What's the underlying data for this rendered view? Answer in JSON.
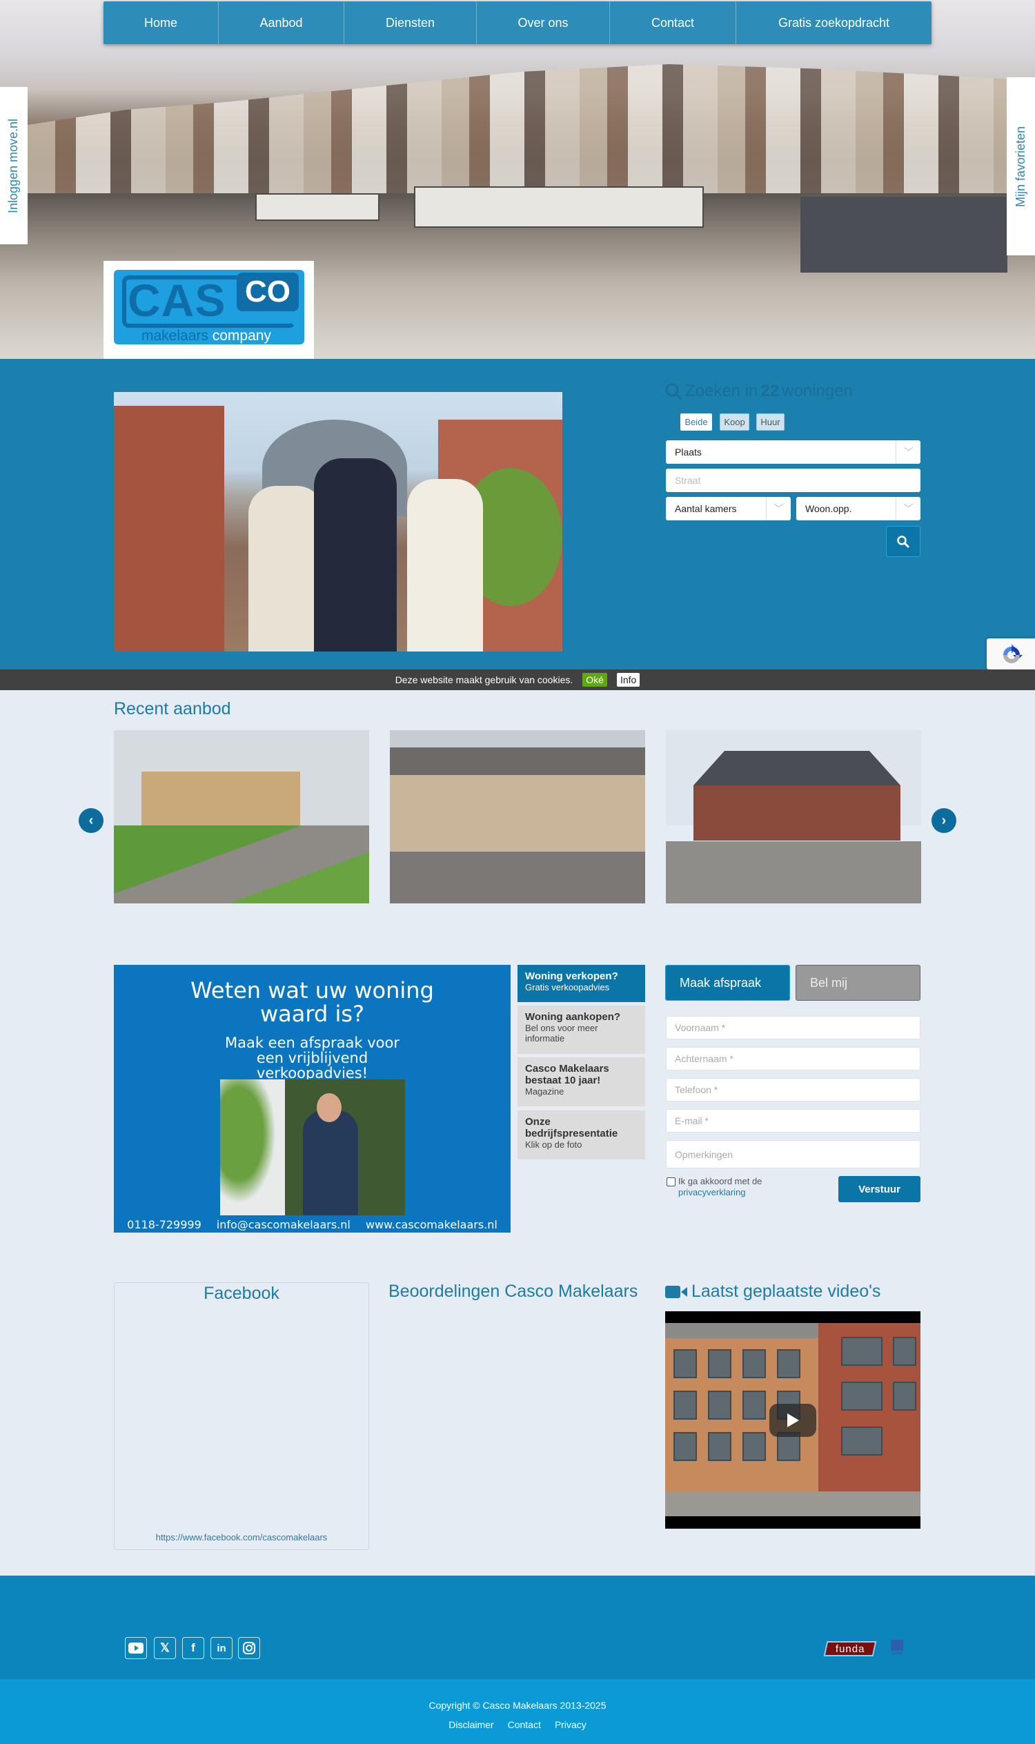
{
  "nav": {
    "items": [
      {
        "label": "Home"
      },
      {
        "label": "Aanbod"
      },
      {
        "label": "Diensten"
      },
      {
        "label": "Over ons"
      },
      {
        "label": "Contact"
      },
      {
        "label": "Gratis zoekopdracht"
      }
    ]
  },
  "side_tabs": {
    "login": "Inloggen move.nl",
    "favorites": "Mijn favorieten"
  },
  "logo": {
    "main": "CAS",
    "co": "CO",
    "tag_left": "makelaars",
    "tag_right": "company"
  },
  "search": {
    "title_prefix": "Zoeken in",
    "count": "22",
    "title_suffix": "woningen",
    "types": [
      "Beide",
      "Koop",
      "Huur"
    ],
    "active_type": "Beide",
    "plaats": "Plaats",
    "straat_placeholder": "Straat",
    "kamers": "Aantal kamers",
    "woonopp": "Woon.opp."
  },
  "cookie": {
    "text": "Deze website maakt gebruik van cookies.",
    "ok": "Oké",
    "info": "Info"
  },
  "recent": {
    "title": "Recent aanbod",
    "prev": "‹",
    "next": "›",
    "listings": [
      {
        "alt": "Appartementencomplex"
      },
      {
        "alt": "Rijwoningen"
      },
      {
        "alt": "Hoekwoning"
      }
    ]
  },
  "promo": {
    "heading": "Weten wat uw woning waard is?",
    "sub": "Maak een afspraak voor een vrijblijvend verkoopadvies!",
    "phone": "0118-729999",
    "email": "info@cascomakelaars.nl",
    "website": "www.cascomakelaars.nl"
  },
  "side_links": [
    {
      "title": "Woning verkopen?",
      "sub": "Gratis verkoopadvies",
      "active": true
    },
    {
      "title": "Woning aankopen?",
      "sub": "Bel ons voor meer informatie",
      "active": false
    },
    {
      "title": "Casco Makelaars bestaat 10 jaar!",
      "sub": "Magazine",
      "active": false
    },
    {
      "title": "Onze bedrijfspresentatie",
      "sub": "Klik op de foto",
      "active": false
    }
  ],
  "form": {
    "tab_active": "Maak afspraak",
    "tab_inactive": "Bel mij",
    "voornaam": "Voornaam *",
    "achternaam": "Achternaam *",
    "telefoon": "Telefoon *",
    "email": "E-mail *",
    "opmerkingen": "Opmerkingen",
    "agree_text": "Ik ga akkoord met de",
    "agree_link": "privacyverklaring",
    "submit": "Verstuur"
  },
  "facebook": {
    "title": "Facebook",
    "url": "https://www.facebook.com/cascomakelaars"
  },
  "reviews": {
    "title": "Beoordelingen Casco Makelaars"
  },
  "videos": {
    "title": "Laatst geplaatste video's"
  },
  "footer": {
    "social": [
      "youtube",
      "x",
      "facebook",
      "linkedin",
      "instagram"
    ],
    "funda": "funda",
    "nvm": "NVM",
    "copyright": "Copyright © Casco Makelaars 2013-2025",
    "links": [
      "Disclaimer",
      "Contact",
      "Privacy"
    ]
  },
  "colors": {
    "nav": "#2d8db8",
    "band": "#1b80ad",
    "accent": "#0b75a8",
    "promo": "#0b75bf",
    "footer_top": "#0c85bd",
    "footer_bottom": "#0a9bd7",
    "page_bg": "#e5ecf3"
  }
}
